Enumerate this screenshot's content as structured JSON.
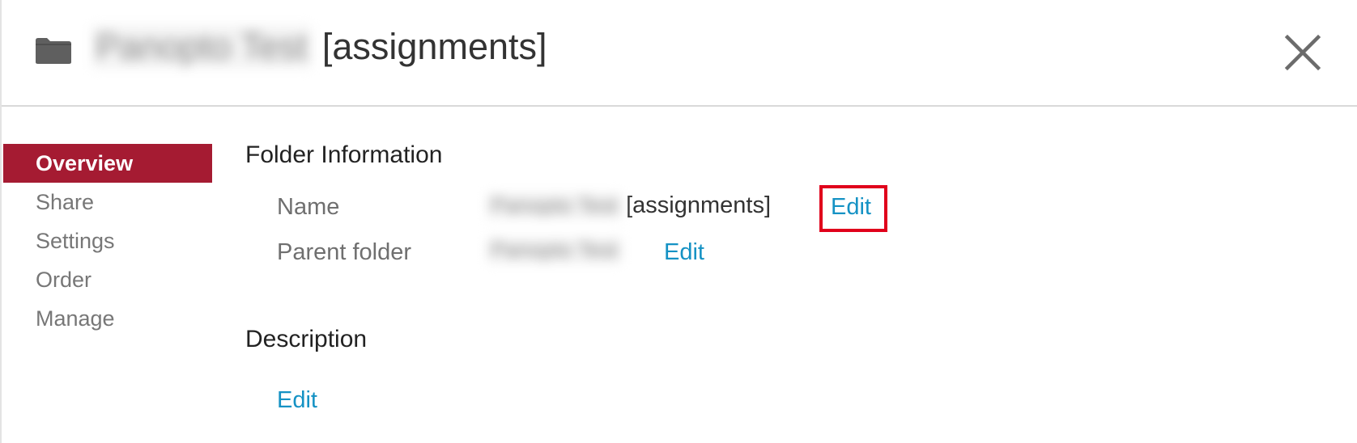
{
  "header": {
    "folder_name_obscured": "Panopto Test",
    "folder_suffix": "[assignments]",
    "close_icon": "close-icon",
    "folder_icon": "folder-icon"
  },
  "sidebar": {
    "items": [
      {
        "label": "Overview",
        "active": true
      },
      {
        "label": "Share",
        "active": false
      },
      {
        "label": "Settings",
        "active": false
      },
      {
        "label": "Order",
        "active": false
      },
      {
        "label": "Manage",
        "active": false
      }
    ]
  },
  "folder_information": {
    "title": "Folder Information",
    "name": {
      "label": "Name",
      "value_obscured": "Panopto Test",
      "value_suffix": "[assignments]",
      "edit_label": "Edit",
      "highlighted": true
    },
    "parent_folder": {
      "label": "Parent folder",
      "value_obscured": "Panopto Test",
      "edit_label": "Edit"
    }
  },
  "description": {
    "title": "Description",
    "edit_label": "Edit"
  },
  "colors": {
    "accent": "#a51b32",
    "link": "#1592c4",
    "highlight": "#e0001b"
  }
}
